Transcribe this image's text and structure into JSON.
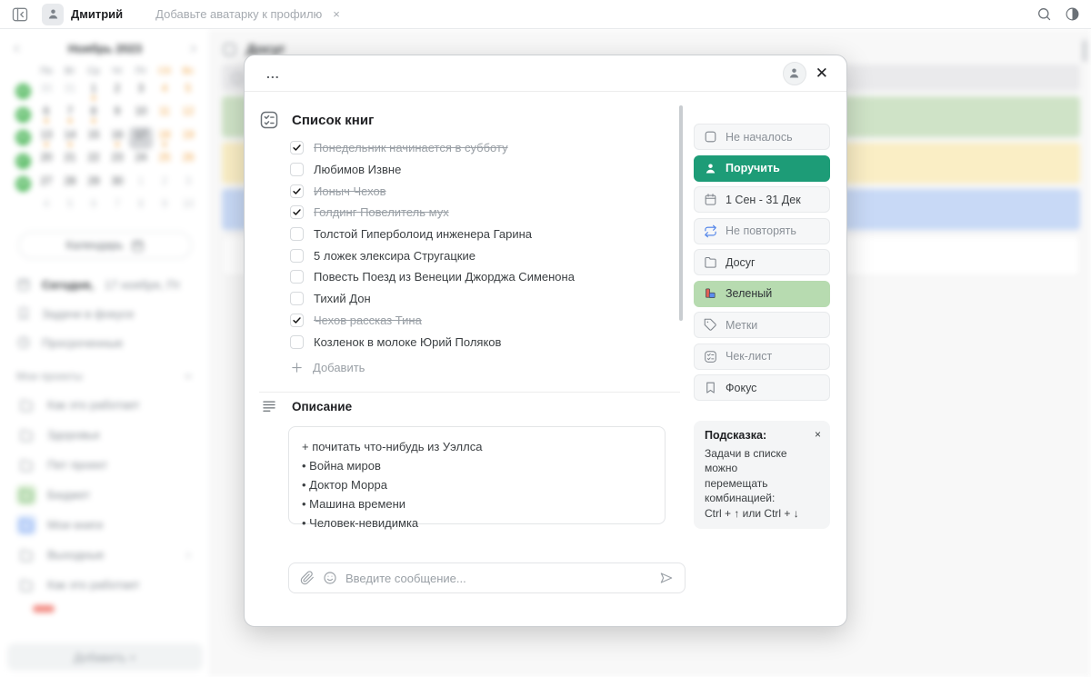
{
  "colors": {
    "accent_green": "#1d9c77",
    "light_green": "#b7dbb0",
    "repeat_blue": "#4a7fe8",
    "row_green": "#cfe3c7",
    "row_yellow": "#faeec5",
    "row_blue": "#c8d9f6"
  },
  "topbar": {
    "user_name": "Дмитрий",
    "avatar_hint": "Добавьте аватарку к профилю",
    "hint_close_glyph": "×"
  },
  "calendar": {
    "title": "Ноябрь 2023",
    "weekdays": [
      "Пн",
      "Вт",
      "Ср",
      "Чт",
      "Пт",
      "Сб",
      "Вс"
    ],
    "week_numbers": [
      "44",
      "45",
      "46",
      "47",
      "48",
      ""
    ],
    "weeks": [
      [
        "30p",
        "31p",
        "1",
        "2",
        "3",
        "4",
        "5"
      ],
      [
        "6",
        "7",
        "8",
        "9",
        "10",
        "11",
        "12"
      ],
      [
        "13",
        "14",
        "15",
        "16",
        "17",
        "18",
        "19"
      ],
      [
        "20",
        "21",
        "22",
        "23",
        "24",
        "25",
        "26"
      ],
      [
        "27",
        "28",
        "29",
        "30",
        "1n",
        "2n",
        "3n"
      ],
      [
        "4n",
        "5n",
        "6n",
        "7n",
        "8n",
        "9n",
        "10n"
      ]
    ],
    "selected": "17",
    "dot_days": [
      "1",
      "6",
      "7",
      "8",
      "13",
      "14",
      "16",
      "18"
    ]
  },
  "sidebar": {
    "calendar_button": "Календарь",
    "items": [
      {
        "icon": "calendar-icon",
        "strong": "Сегодня,",
        "rest": " 17 ноября, Пт"
      },
      {
        "icon": "bookmark-icon",
        "strong": "",
        "rest": "Задачи в фокусе"
      },
      {
        "icon": "clock-icon",
        "strong": "",
        "rest": "Просроченные"
      }
    ],
    "projects_header": "Мои проекты",
    "projects": [
      {
        "label": "Как это работает",
        "color": ""
      },
      {
        "label": "Здоровье",
        "color": ""
      },
      {
        "label": "Пет проект",
        "color": ""
      },
      {
        "label": "Бюджет",
        "color": "green"
      },
      {
        "label": "Мои книги",
        "color": "blue"
      },
      {
        "label": "Выходные",
        "color": "",
        "chevron": true
      },
      {
        "label": "Как это работает",
        "color": ""
      }
    ],
    "add_button": "Добавить +"
  },
  "main": {
    "page_title": "Досуг",
    "rows": [
      {
        "name": "task-row-green",
        "color": "#cfe3c7"
      },
      {
        "name": "task-row-yellow",
        "color": "#faeec5"
      },
      {
        "name": "task-row-blue",
        "color": "#c8d9f6"
      },
      {
        "name": "task-row-white",
        "color": "#ffffff"
      }
    ]
  },
  "modal": {
    "menu_label": "...",
    "close_glyph": "✕",
    "checklist": {
      "title": "Список книг",
      "add_label": "Добавить",
      "items": [
        {
          "text": "Понедельник начинается в субботу",
          "checked": true
        },
        {
          "text": "Любимов Извне",
          "checked": false
        },
        {
          "text": "Ионыч Чехов",
          "checked": true
        },
        {
          "text": "Голдинг Повелитель мух",
          "checked": true
        },
        {
          "text": "Толстой Гиперболоид инженера Гарина",
          "checked": false
        },
        {
          "text": "5 ложек элексира Стругацкие",
          "checked": false
        },
        {
          "text": "Повесть Поезд из Венеции Джорджа Сименона",
          "checked": false
        },
        {
          "text": "Тихий Дон",
          "checked": false
        },
        {
          "text": "Чехов рассказ Тина",
          "checked": true
        },
        {
          "text": "Козленок в молоке Юрий Поляков",
          "checked": false
        }
      ]
    },
    "description": {
      "title": "Описание",
      "lines": [
        "+ почитать что-нибудь из Уэллса",
        "• Война миров",
        "• Доктор Морра",
        "• Машина времени",
        "• Человек-невидимка"
      ]
    },
    "message": {
      "placeholder": "Введите сообщение..."
    },
    "actions": [
      {
        "name": "status",
        "icon": "checkbox-icon",
        "label": "Не началось",
        "variant": "default",
        "text": "gray"
      },
      {
        "name": "assign",
        "icon": "person-icon",
        "label": "Поручить",
        "variant": "green",
        "text": ""
      },
      {
        "name": "dates",
        "icon": "calendar-icon",
        "label": "1 Сен - 31 Дек",
        "variant": "default",
        "text": "dark"
      },
      {
        "name": "repeat",
        "icon": "repeat-icon",
        "label": "Не повторять",
        "variant": "default",
        "text": "gray"
      },
      {
        "name": "project",
        "icon": "folder-icon",
        "label": "Досуг",
        "variant": "default",
        "text": "dark"
      },
      {
        "name": "color",
        "icon": "palette-icon",
        "label": "Зеленый",
        "variant": "lightgreen",
        "text": "dark"
      },
      {
        "name": "tags",
        "icon": "tag-icon",
        "label": "Метки",
        "variant": "default",
        "text": "gray"
      },
      {
        "name": "checklist",
        "icon": "checklist-icon",
        "label": "Чек-лист",
        "variant": "default",
        "text": "gray"
      },
      {
        "name": "focus",
        "icon": "bookmark-icon",
        "label": "Фокус",
        "variant": "default",
        "text": "dark"
      }
    ],
    "hint": {
      "title": "Подсказка:",
      "close_glyph": "×",
      "lines": [
        "Задачи в списке можно",
        "перемещать комбинацией:",
        "Ctrl + ↑ или Ctrl + ↓"
      ]
    }
  }
}
